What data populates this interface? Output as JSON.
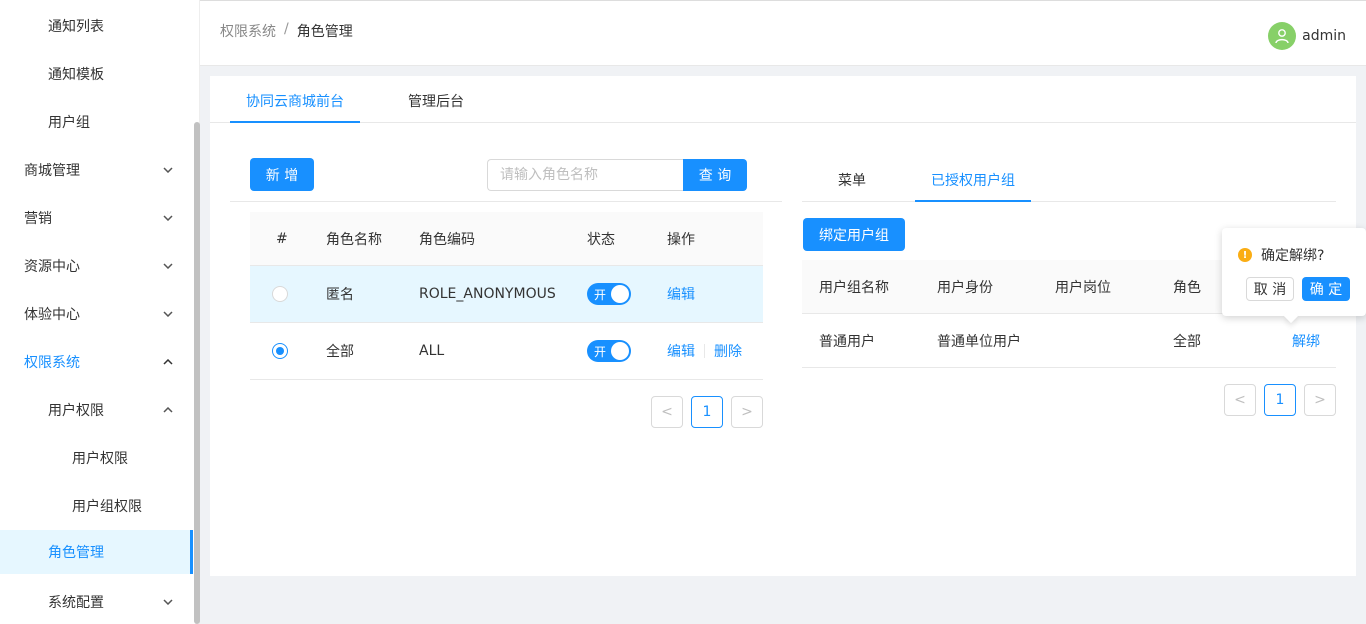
{
  "sidebar": {
    "items": [
      {
        "label": "通知列表"
      },
      {
        "label": "通知模板"
      },
      {
        "label": "用户组"
      },
      {
        "label": "商城管理"
      },
      {
        "label": "营销"
      },
      {
        "label": "资源中心"
      },
      {
        "label": "体验中心"
      },
      {
        "label": "权限系统"
      },
      {
        "label": "用户权限"
      },
      {
        "label": "用户权限"
      },
      {
        "label": "用户组权限"
      },
      {
        "label": "角色管理"
      },
      {
        "label": "系统配置"
      }
    ]
  },
  "header": {
    "breadcrumb": [
      "权限系统",
      "/",
      "角色管理"
    ],
    "username": "admin"
  },
  "main": {
    "tabs": [
      {
        "label": "协同云商城前台"
      },
      {
        "label": "管理后台"
      }
    ],
    "add_button": "新 增",
    "search": {
      "placeholder": "请输入角色名称",
      "button": "查 询"
    },
    "roles_table": {
      "columns": [
        "#",
        "角色名称",
        "角色编码",
        "状态",
        "操作"
      ],
      "rows": [
        {
          "name": "匿名",
          "code": "ROLE_ANONYMOUS",
          "status": "开",
          "actions": [
            "编辑"
          ],
          "selected": false
        },
        {
          "name": "全部",
          "code": "ALL",
          "status": "开",
          "actions": [
            "编辑",
            "删除"
          ],
          "selected": true
        }
      ]
    },
    "left_pager": {
      "prev": "<",
      "page": "1",
      "next": ">"
    },
    "right": {
      "tabs": [
        {
          "label": "菜单"
        },
        {
          "label": "已授权用户组"
        }
      ],
      "bind_button": "绑定用户组",
      "table": {
        "columns": [
          "用户组名称",
          "用户身份",
          "用户岗位",
          "角色"
        ],
        "rows": [
          {
            "group": "普通用户",
            "identity": "普通单位用户",
            "post": "",
            "role": "全部",
            "action": "解绑"
          }
        ]
      },
      "pager": {
        "prev": "<",
        "page": "1",
        "next": ">"
      }
    }
  },
  "popconfirm": {
    "message": "确定解绑?",
    "cancel": "取 消",
    "ok": "确 定"
  },
  "colors": {
    "primary": "#1890ff",
    "avatar": "#87d068",
    "warning": "#faad14"
  }
}
